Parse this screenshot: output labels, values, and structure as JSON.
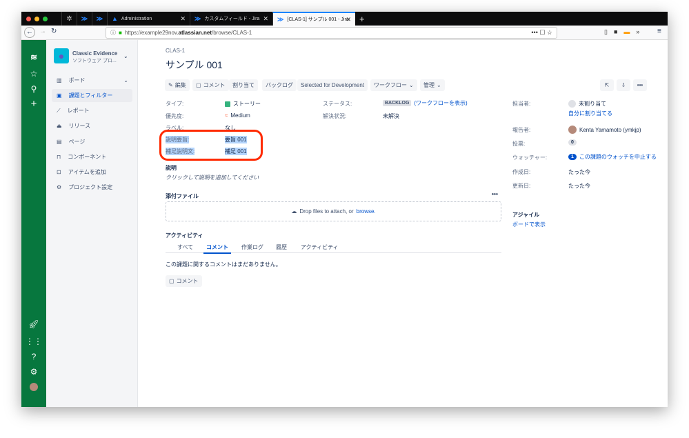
{
  "browser": {
    "tabs": [
      {
        "label": "Administration"
      },
      {
        "label": "カスタムフィールド - Jira"
      },
      {
        "label": "[CLAS-1] サンプル 001 - Jira"
      }
    ],
    "url_prefix": "https://example29nov.",
    "url_domain": "atlassian.net",
    "url_path": "/browse/CLAS-1"
  },
  "project": {
    "name": "Classic Evidence",
    "type": "ソフトウェア プロ..."
  },
  "sidebar": {
    "items": [
      {
        "label": "ボード"
      },
      {
        "label": "課題とフィルター"
      },
      {
        "label": "レポート"
      },
      {
        "label": "リリース"
      },
      {
        "label": "ページ"
      },
      {
        "label": "コンポーネント"
      },
      {
        "label": "アイテムを追加"
      },
      {
        "label": "プロジェクト設定"
      }
    ]
  },
  "issue": {
    "key": "CLAS-1",
    "title": "サンプル 001"
  },
  "actions": {
    "edit": "編集",
    "comment": "コメント",
    "assign": "割り当て",
    "backlog": "バックログ",
    "selected": "Selected for Development",
    "workflow": "ワークフロー",
    "admin": "管理"
  },
  "details": {
    "type_label": "タイプ:",
    "type_value": "ストーリー",
    "priority_label": "優先度:",
    "priority_value": "Medium",
    "labels_label": "ラベル:",
    "labels_value": "なし",
    "summary_label": "説明要旨:",
    "summary_value": "要旨 001",
    "supp_label": "補足説明文:",
    "supp_value": "補足 001",
    "status_label": "ステータス:",
    "status_value": "BACKLOG",
    "status_link": "(ワークフローを表示)",
    "resolution_label": "解決状況:",
    "resolution_value": "未解決"
  },
  "description": {
    "heading": "説明",
    "placeholder": "クリックして説明を追加してください"
  },
  "attachments": {
    "heading": "添付ファイル",
    "drop_text": "Drop files to attach, or ",
    "browse": "browse."
  },
  "activity": {
    "heading": "アクティビティ",
    "tabs": [
      "すべて",
      "コメント",
      "作業ログ",
      "履歴",
      "アクティビティ"
    ],
    "empty": "この課題に関するコメントはまだありません。",
    "comment_button": "コメント"
  },
  "people": {
    "assignee_label": "担当者:",
    "assignee_value": "未割り当て",
    "assign_me": "自分に割り当てる",
    "reporter_label": "報告者:",
    "reporter_value": "Kenta Yamamoto (ymkjp)",
    "votes_label": "投票:",
    "votes_value": "0",
    "watchers_label": "ウォッチャー:",
    "watchers_count": "1",
    "watch_stop": "この課題のウォッチを中止する",
    "created_label": "作成日:",
    "created_value": "たった今",
    "updated_label": "更新日:",
    "updated_value": "たった今"
  },
  "agile": {
    "heading": "アジャイル",
    "link": "ボードで表示"
  },
  "colors": {
    "nav": "#07773e",
    "link": "#0052cc",
    "highlight": "#b3d4fc",
    "annotation": "#ff2a00"
  }
}
